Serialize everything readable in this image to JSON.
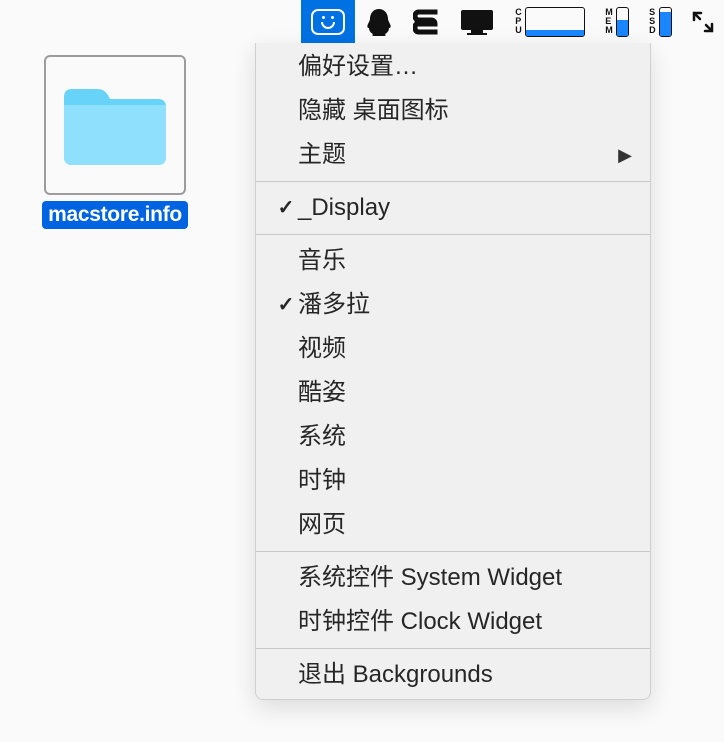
{
  "desktop": {
    "folder_label": "macstore.info"
  },
  "menubar": {
    "stats": {
      "cpu_label": [
        "C",
        "P",
        "U"
      ],
      "mem_label": [
        "M",
        "E",
        "M"
      ],
      "ssd_label": [
        "S",
        "S",
        "D"
      ],
      "mem_fill_pct": 55,
      "ssd_fill_pct": 85
    }
  },
  "menu": {
    "section1": {
      "preferences": "偏好设置…",
      "hide_icons": "隐藏 桌面图标",
      "theme": "主题"
    },
    "section2": {
      "display": "_Display",
      "display_checked": true
    },
    "section3": {
      "music": "音乐",
      "pandora": "潘多拉",
      "pandora_checked": true,
      "video": "视频",
      "cool": "酷姿",
      "system": "系统",
      "clock": "时钟",
      "web": "网页"
    },
    "section4": {
      "system_widget": "系统控件 System Widget",
      "clock_widget": "时钟控件 Clock Widget"
    },
    "section5": {
      "quit": "退出 Backgrounds"
    }
  }
}
